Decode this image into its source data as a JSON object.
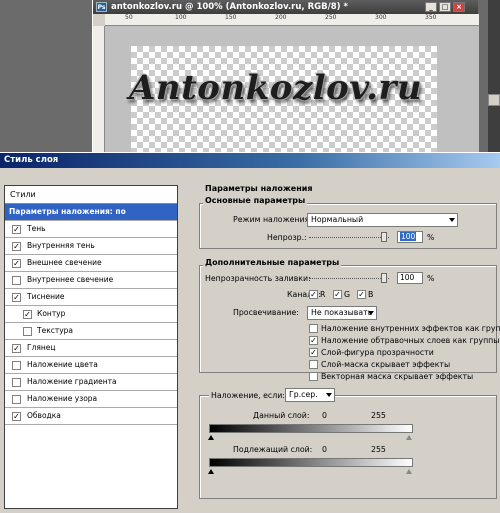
{
  "document": {
    "title": "antonkozlov.ru @ 100% (Antonkozlov.ru, RGB/8) *",
    "app_icon": "Ps",
    "canvas_text": "Antonkozlov.ru",
    "ruler_marks": [
      "50",
      "100",
      "150",
      "200",
      "250",
      "300",
      "350"
    ],
    "window_buttons": [
      "_",
      "□",
      "×"
    ]
  },
  "dialog": {
    "title": "Стиль слоя",
    "styles_header": "Стили",
    "style_items": [
      {
        "label": "Параметры наложения: по умолчанию",
        "selected": true
      },
      {
        "label": "Тень",
        "checked": true
      },
      {
        "label": "Внутренняя тень",
        "checked": true
      },
      {
        "label": "Внешнее свечение",
        "checked": true
      },
      {
        "label": "Внутреннее свечение",
        "checked": false
      },
      {
        "label": "Тиснение",
        "checked": true
      },
      {
        "label": "Контур",
        "checked": true
      },
      {
        "label": "Текстура",
        "checked": false
      },
      {
        "label": "Глянец",
        "checked": true
      },
      {
        "label": "Наложение цвета",
        "checked": false
      },
      {
        "label": "Наложение градиента",
        "checked": false
      },
      {
        "label": "Наложение узора",
        "checked": false
      },
      {
        "label": "Обводка",
        "checked": true
      }
    ],
    "blending": {
      "title": "Параметры наложения",
      "general": {
        "title": "Основные параметры",
        "mode_label": "Режим наложения:",
        "mode_value": "Нормальный",
        "opacity_label": "Непрозр.:",
        "opacity_value": "100",
        "opacity_unit": "%",
        "opacity_level": 1.0
      },
      "advanced": {
        "title": "Дополнительные параметры",
        "fill_label": "Непрозрачность заливки:",
        "fill_value": "100",
        "fill_unit": "%",
        "fill_level": 1.0,
        "channels_label": "Каналы:",
        "channels": [
          {
            "label": "R",
            "checked": true
          },
          {
            "label": "G",
            "checked": true
          },
          {
            "label": "B",
            "checked": true
          }
        ],
        "knockout_label": "Просвечивание:",
        "knockout_value": "Не показывать",
        "options": [
          {
            "label": "Наложение внутренних эффектов как группы",
            "checked": false
          },
          {
            "label": "Наложение обтравочных слоев как группы",
            "checked": true
          },
          {
            "label": "Слой-фигура прозрачности",
            "checked": true
          },
          {
            "label": "Слой-маска скрывает эффекты",
            "checked": false
          },
          {
            "label": "Векторная маска скрывает эффекты",
            "checked": false
          }
        ]
      },
      "blend_if": {
        "label": "Наложение, если:",
        "value": "Гр.сер.",
        "this_layer_label": "Данный слой:",
        "this_layer_min": "0",
        "this_layer_max": "255",
        "underlying_label": "Подлежащий слой:",
        "underlying_min": "0",
        "underlying_max": "255"
      }
    }
  }
}
